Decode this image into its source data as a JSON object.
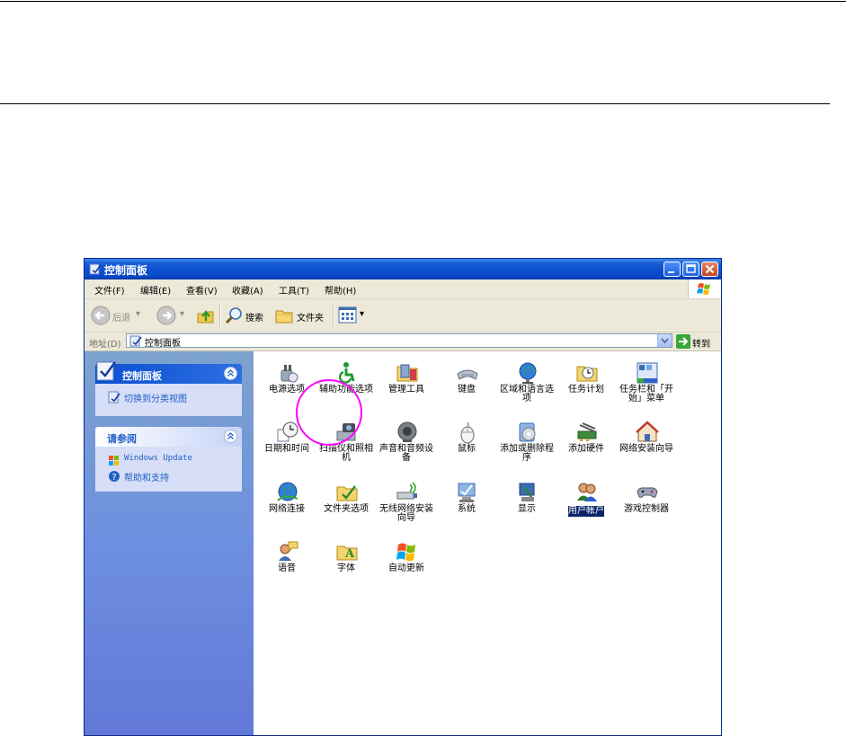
{
  "window": {
    "title": "控制面板"
  },
  "menu": [
    "文件(F)",
    "编辑(E)",
    "查看(V)",
    "收藏(A)",
    "工具(T)",
    "帮助(H)"
  ],
  "toolbar": {
    "back": "后退",
    "search": "搜索",
    "folders": "文件夹"
  },
  "address": {
    "label": "地址(D)",
    "value": "控制面板",
    "go": "转到"
  },
  "sidebar": {
    "panel1": {
      "title": "控制面板",
      "link": "切换到分类视图"
    },
    "panel2": {
      "title": "请参阅",
      "links": [
        "Windows Update",
        "帮助和支持"
      ]
    }
  },
  "icons": [
    {
      "label": "电源选项",
      "icon": "power-options-icon"
    },
    {
      "label": "辅助功能选项",
      "icon": "accessibility-icon"
    },
    {
      "label": "管理工具",
      "icon": "admin-tools-icon"
    },
    {
      "label": "键盘",
      "icon": "keyboard-icon"
    },
    {
      "label": "区域和语言选项",
      "icon": "globe-icon"
    },
    {
      "label": "任务计划",
      "icon": "scheduled-tasks-icon"
    },
    {
      "label": "任务栏和「开始」菜单",
      "icon": "taskbar-icon"
    },
    {
      "label": "日期和时间",
      "icon": "clock-icon"
    },
    {
      "label": "扫描仪和照相机",
      "icon": "scanner-icon"
    },
    {
      "label": "声音和音频设备",
      "icon": "speaker-icon"
    },
    {
      "label": "鼠标",
      "icon": "mouse-icon"
    },
    {
      "label": "添加或删除程序",
      "icon": "add-remove-icon"
    },
    {
      "label": "添加硬件",
      "icon": "add-hardware-icon"
    },
    {
      "label": "网络安装向导",
      "icon": "network-wizard-icon"
    },
    {
      "label": "网络连接",
      "icon": "network-connections-icon"
    },
    {
      "label": "文件夹选项",
      "icon": "folder-options-icon"
    },
    {
      "label": "无线网络安装向导",
      "icon": "wireless-wizard-icon"
    },
    {
      "label": "系统",
      "icon": "system-icon"
    },
    {
      "label": "显示",
      "icon": "display-icon"
    },
    {
      "label": "用户帐户",
      "icon": "user-accounts-icon"
    },
    {
      "label": "游戏控制器",
      "icon": "game-controller-icon"
    },
    {
      "label": "语音",
      "icon": "speech-icon"
    },
    {
      "label": "字体",
      "icon": "fonts-icon"
    },
    {
      "label": "自动更新",
      "icon": "windows-update-icon"
    }
  ]
}
